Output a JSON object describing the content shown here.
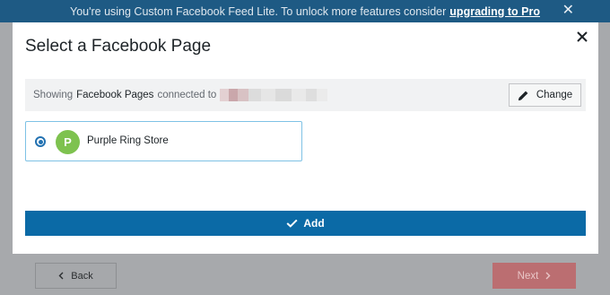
{
  "banner": {
    "message": "You're using Custom Facebook Feed Lite. To unlock more features consider",
    "link_text": "upgrading to Pro",
    "close_glyph": "✕"
  },
  "footer": {
    "back_label": "Back",
    "next_label": "Next",
    "back_icon": "chevron-left-icon",
    "next_icon": "chevron-right-icon"
  },
  "modal": {
    "title": "Select a Facebook Page",
    "info": {
      "prefix": "Showing",
      "strong": "Facebook Pages",
      "suffix": "connected to"
    },
    "change_label": "Change",
    "pages": [
      {
        "initial": "P",
        "name": "Purple Ring Store",
        "selected": true
      }
    ],
    "add_label": "Add"
  },
  "colors": {
    "banner_bg": "#1e5a84",
    "primary": "#0b6aa6",
    "avatar": "#7ec24f",
    "next_button": "#bb6e71",
    "selected_border": "#7ec2e5"
  }
}
